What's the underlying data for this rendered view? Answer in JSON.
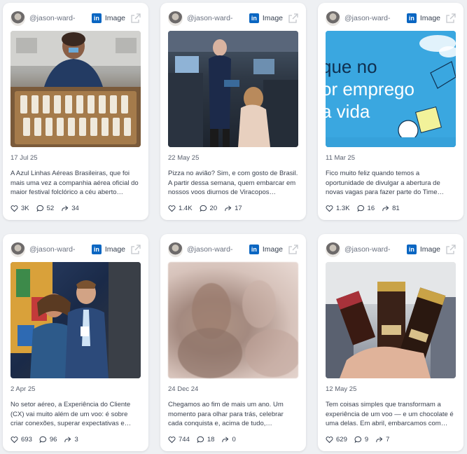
{
  "cards": [
    {
      "handle": "@jason-ward-",
      "type": "Image",
      "date": "17 Jul 25",
      "text": "A Azul Linhas Aéreas Brasileiras, que foi mais uma vez a companhia aérea oficial do maior festival folclórico a céu aberto…",
      "likes": "3K",
      "comments": "52",
      "shares": "34"
    },
    {
      "handle": "@jason-ward-",
      "type": "Image",
      "date": "22 May 25",
      "text": "Pizza no avião? Sim, e com gosto de Brasil. A partir dessa semana, quem embarcar em nossos voos diurnos de Viracopos…",
      "likes": "1.4K",
      "comments": "20",
      "shares": "17"
    },
    {
      "handle": "@jason-ward-",
      "type": "Image",
      "date": "11 Mar 25",
      "text": "Fico muito feliz quando temos a oportunidade de divulgar a abertura de novas vagas para fazer parte do Time…",
      "likes": "1.3K",
      "comments": "16",
      "shares": "81",
      "image_text": [
        "que no",
        "or emprego",
        "a vida"
      ]
    },
    {
      "handle": "@jason-ward-",
      "type": "Image",
      "date": "2 Apr 25",
      "text": "No setor aéreo, a Experiência do Cliente (CX) vai muito além de um voo: é sobre criar conexões, superar expectativas e…",
      "likes": "693",
      "comments": "96",
      "shares": "3"
    },
    {
      "handle": "@jason-ward-",
      "type": "Image",
      "date": "24 Dec 24",
      "text": "Chegamos ao fim de mais um ano. Um momento para olhar para trás, celebrar cada conquista e, acima de tudo,…",
      "likes": "744",
      "comments": "18",
      "shares": "0"
    },
    {
      "handle": "@jason-ward-",
      "type": "Image",
      "date": "12 May 25",
      "text": "Tem coisas simples que transformam a experiência de um voo — e um chocolate é uma delas. Em abril, embarcamos com…",
      "likes": "629",
      "comments": "9",
      "shares": "7"
    }
  ],
  "icons": {
    "platform": "linkedin-icon",
    "external": "external-link-icon",
    "like": "heart-icon",
    "comment": "comment-icon",
    "share": "share-icon"
  },
  "colors": {
    "linkedin": "#0a66c2",
    "card_bg": "#ffffff",
    "page_bg": "#eef0f3"
  }
}
